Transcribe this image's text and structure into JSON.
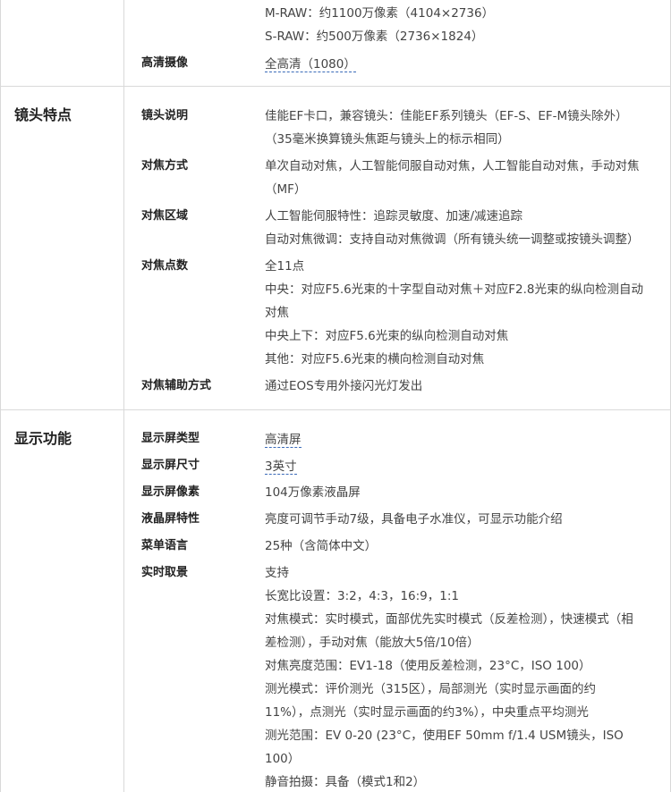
{
  "sections": {
    "top": {
      "lines": [
        "M-RAW：约1100万像素（4104×2736）",
        "S-RAW：约500万像素（2736×1824）"
      ],
      "rows": [
        {
          "label": "高清摄像",
          "lines": [
            "全高清（1080）"
          ]
        }
      ]
    },
    "lens": {
      "title": "镜头特点",
      "rows": [
        {
          "label": "镜头说明",
          "lines": [
            "佳能EF卡口，兼容镜头：佳能EF系列镜头（EF-S、EF-M镜头除外）",
            "（35毫米换算镜头焦距与镜头上的标示相同）"
          ]
        },
        {
          "label": "对焦方式",
          "lines": [
            "单次自动对焦，人工智能伺服自动对焦，人工智能自动对焦，手动对焦",
            "（MF）"
          ]
        },
        {
          "label": "对焦区域",
          "lines": [
            "人工智能伺服特性：追踪灵敏度、加速/减速追踪",
            "自动对焦微调：支持自动对焦微调（所有镜头统一调整或按镜头调整）"
          ]
        },
        {
          "label": "对焦点数",
          "lines": [
            "全11点",
            "中央：对应F5.6光束的十字型自动对焦＋对应F2.8光束的纵向检测自动",
            "对焦",
            "中央上下：对应F5.6光束的纵向检测自动对焦",
            "其他：对应F5.6光束的横向检测自动对焦"
          ]
        },
        {
          "label": "对焦辅助方式",
          "lines": [
            "通过EOS专用外接闪光灯发出"
          ]
        }
      ]
    },
    "display": {
      "title": "显示功能",
      "rows": [
        {
          "label": "显示屏类型",
          "lines": [
            "高清屏"
          ]
        },
        {
          "label": "显示屏尺寸",
          "lines": [
            "3英寸"
          ]
        },
        {
          "label": "显示屏像素",
          "lines": [
            "104万像素液晶屏"
          ]
        },
        {
          "label": "液晶屏特性",
          "lines": [
            "亮度可调节手动7级，具备电子水准仪，可显示功能介绍"
          ]
        },
        {
          "label": "菜单语言",
          "lines": [
            "25种（含简体中文）"
          ]
        },
        {
          "label": "实时取景",
          "lines": [
            "支持",
            "长宽比设置：3:2，4:3，16:9，1:1",
            "对焦模式：实时模式，面部优先实时模式（反差检测），快速模式（相",
            "差检测），手动对焦（能放大5倍/10倍）",
            "对焦亮度范围：EV1-18（使用反差检测，23°C，ISO 100）",
            "测光模式：评价测光（315区），局部测光（实时显示画面的约",
            "11%），点测光（实时显示画面的约3%），中央重点平均测光",
            "测光范围：EV 0-20 (23°C，使用EF 50mm f/1.4 USM镜头，ISO",
            "100）",
            "静音拍摄：具备（模式1和2）"
          ]
        }
      ]
    }
  }
}
